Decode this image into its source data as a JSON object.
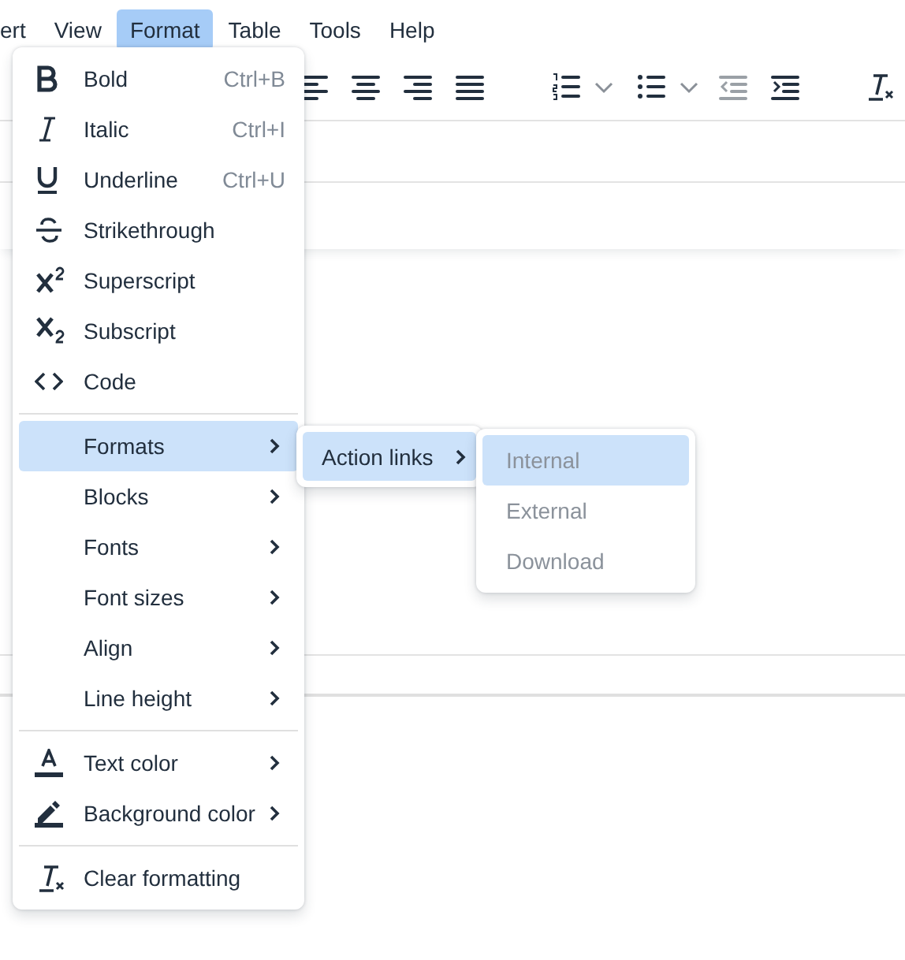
{
  "menubar": [
    {
      "label": "ert",
      "selected": false
    },
    {
      "label": "View",
      "selected": false
    },
    {
      "label": "Format",
      "selected": true
    },
    {
      "label": "Table",
      "selected": false
    },
    {
      "label": "Tools",
      "selected": false
    },
    {
      "label": "Help",
      "selected": false
    }
  ],
  "toolbar": [
    {
      "kind": "alignleft",
      "disabled": false
    },
    {
      "kind": "aligncenter",
      "disabled": false
    },
    {
      "kind": "alignright",
      "disabled": false
    },
    {
      "kind": "justify",
      "disabled": false
    },
    {
      "kind": "numlist",
      "disabled": false
    },
    {
      "kind": "bullist",
      "disabled": false
    },
    {
      "kind": "outdent",
      "disabled": true
    },
    {
      "kind": "indent",
      "disabled": false
    },
    {
      "kind": "clearformat",
      "disabled": false
    }
  ],
  "format_menu": [
    {
      "kind": "bold",
      "label": "Bold",
      "shortcut": "Ctrl+B",
      "submenu": false,
      "selected": false
    },
    {
      "kind": "italic",
      "label": "Italic",
      "shortcut": "Ctrl+I",
      "submenu": false,
      "selected": false
    },
    {
      "kind": "underline",
      "label": "Underline",
      "shortcut": "Ctrl+U",
      "submenu": false,
      "selected": false
    },
    {
      "kind": "strikethrough",
      "label": "Strikethrough",
      "submenu": false,
      "selected": false
    },
    {
      "kind": "superscript",
      "label": "Superscript",
      "submenu": false,
      "selected": false
    },
    {
      "kind": "subscript",
      "label": "Subscript",
      "submenu": false,
      "selected": false
    },
    {
      "kind": "code",
      "label": "Code",
      "submenu": false,
      "selected": false
    },
    {
      "kind": "separator"
    },
    {
      "kind": "plain",
      "label": "Formats",
      "submenu": true,
      "selected": true
    },
    {
      "kind": "plain",
      "label": "Blocks",
      "submenu": true,
      "selected": false
    },
    {
      "kind": "plain",
      "label": "Fonts",
      "submenu": true,
      "selected": false
    },
    {
      "kind": "plain",
      "label": "Font sizes",
      "submenu": true,
      "selected": false
    },
    {
      "kind": "plain",
      "label": "Align",
      "submenu": true,
      "selected": false
    },
    {
      "kind": "plain",
      "label": "Line height",
      "submenu": true,
      "selected": false
    },
    {
      "kind": "separator"
    },
    {
      "kind": "textcolor",
      "label": "Text color",
      "submenu": true,
      "selected": false
    },
    {
      "kind": "highlight",
      "label": "Background color",
      "submenu": true,
      "selected": false
    },
    {
      "kind": "separator"
    },
    {
      "kind": "clearformat",
      "label": "Clear formatting",
      "submenu": false,
      "selected": false
    }
  ],
  "formats_submenu": [
    {
      "label": "Action links",
      "submenu": true,
      "selected": true
    }
  ],
  "action_links_submenu": [
    {
      "label": "Internal",
      "selected": true,
      "disabled": true
    },
    {
      "label": "External",
      "selected": false,
      "disabled": true
    },
    {
      "label": "Download",
      "selected": false,
      "disabled": true
    }
  ]
}
